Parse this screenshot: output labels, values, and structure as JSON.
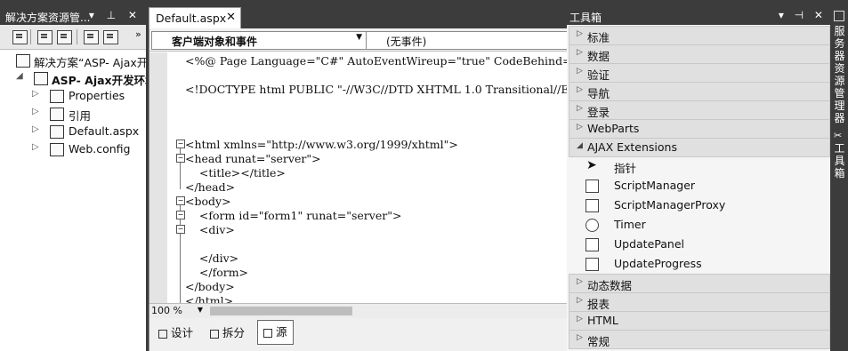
{
  "solution_explorer": {
    "title": "解决方案资源管...",
    "items": [
      {
        "label": "解决方案“ASP- Ajax开发"
      },
      {
        "label": "ASP- Ajax开发环境"
      },
      {
        "label": "Properties"
      },
      {
        "label": "引用"
      },
      {
        "label": "Default.aspx"
      },
      {
        "label": "Web.config"
      }
    ]
  },
  "editor": {
    "tab_label": "Default.aspx",
    "object_dropdown": "客户端对象和事件",
    "event_dropdown": "(无事件)",
    "zoom": "100 %",
    "lines": [
      "<%@ Page Language=\"C#\" AutoEventWireup=\"true\" CodeBehind=\"Def",
      "",
      "<!DOCTYPE html PUBLIC \"-//W3C//DTD XHTML 1.0 Transitional//EN",
      "",
      "<html xmlns=\"http://www.w3.org/1999/xhtml\">",
      "<head runat=\"server\">",
      "    <title></title>",
      "</head>",
      "<body>",
      "    <form id=\"form1\" runat=\"server\">",
      "    <div>",
      "",
      "    </div>",
      "    </form>",
      "</body>",
      "</html>"
    ],
    "view_buttons": [
      "设计",
      "拆分",
      "源"
    ]
  },
  "toolbox": {
    "title": "工具箱",
    "categories_top": [
      "标准",
      "数据",
      "验证",
      "导航",
      "登录",
      "WebParts"
    ],
    "expanded": "AJAX Extensions",
    "items": [
      "指针",
      "ScriptManager",
      "ScriptManagerProxy",
      "Timer",
      "UpdatePanel",
      "UpdateProgress"
    ],
    "categories_bottom": [
      "动态数据",
      "报表",
      "HTML",
      "常规"
    ]
  },
  "side_strip": {
    "server_explorer": "服务器资源管理器",
    "toolbox": "工具箱"
  }
}
